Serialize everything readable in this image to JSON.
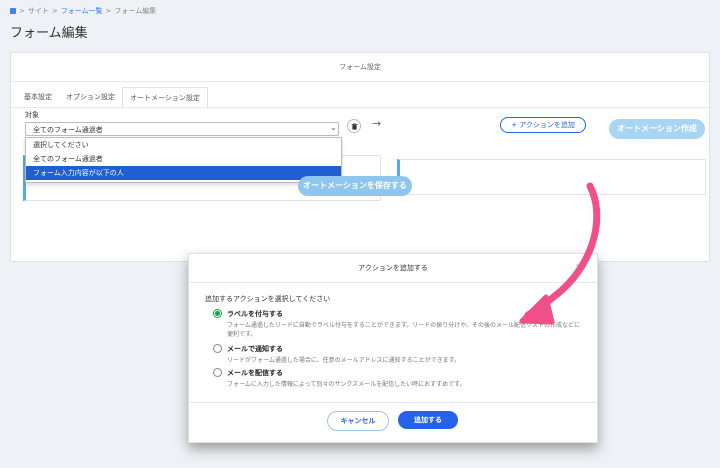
{
  "breadcrumb": {
    "site": "サイト",
    "form_list": "フォーム一覧",
    "current": "フォーム編集",
    "sep": ">"
  },
  "page_title": "フォーム編集",
  "panel": {
    "header": "フォーム設定",
    "tabs": [
      "基本設定",
      "オプション設定",
      "オートメーション設定"
    ],
    "active_tab": "オートメーション設定",
    "create_automation": "オートメーション作成",
    "condition_label": "対象",
    "condition_selected": "全てのフォーム通過者",
    "dropdown_options": [
      "選択してください",
      "全てのフォーム通過者",
      "フォーム入力内容が以下の人"
    ],
    "dropdown_highlight": "フォーム入力内容が以下の人",
    "add_action": "+ アクションを追加",
    "save_automation": "オートメーションを保存する"
  },
  "modal": {
    "title": "アクションを追加する",
    "close": "×",
    "question": "追加するアクションを選択してください",
    "options": [
      {
        "label": "ラベルを付与する",
        "desc": "フォーム通過したリードに自動でラベル付与をすることができます。リードの振り分けや、その後のメール配信リストの作成などに便利です。",
        "checked": true
      },
      {
        "label": "メールで通知する",
        "desc": "リードがフォーム通過した場合に、任意のメールアドレスに通知することができます。",
        "checked": false
      },
      {
        "label": "メールを配信する",
        "desc": "フォームに入力した情報によって別々のサンクスメールを配信したい時におすすめです。",
        "checked": false
      }
    ],
    "cancel": "キャンセル",
    "add": "追加する"
  },
  "colors": {
    "accent": "#2563eb",
    "arrow": "#f0508a",
    "radio_checked": "#16a34a"
  }
}
